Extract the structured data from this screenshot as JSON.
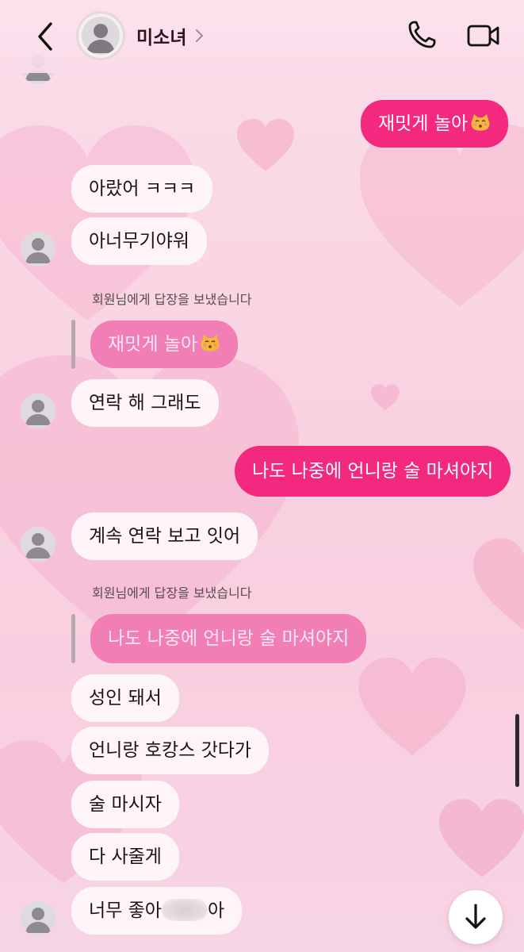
{
  "header": {
    "contact_name": "미소녀",
    "icons": {
      "back": "chevron-left-icon",
      "call": "phone-icon",
      "video": "video-camera-icon",
      "profile_more": "chevron-right-icon"
    }
  },
  "messages": {
    "m1": {
      "text": "재밋게 놀아",
      "emoji": "kissing-cat-emoji"
    },
    "m2": {
      "text": "아랐어 ㅋㅋㅋ"
    },
    "m3": {
      "text": "아너무기야워"
    },
    "reply1_note": "회원님에게 답장을 보냈습니다",
    "reply1_quote": {
      "text": "재밋게 놀아",
      "emoji": "kissing-cat-emoji"
    },
    "m4": {
      "text": "연락 해 그래도"
    },
    "m5": {
      "text": "나도 나중에 언니랑 술 마셔야지"
    },
    "m6": {
      "text": "계속 연락 보고 잇어"
    },
    "reply2_note": "회원님에게 답장을 보냈습니다",
    "reply2_quote": {
      "text": "나도 나중에 언니랑 술 마셔야지"
    },
    "m7": {
      "text": "성인 돼서"
    },
    "m8": {
      "text": "언니랑 호캉스 갓다가"
    },
    "m9": {
      "text": "술 마시자"
    },
    "m10": {
      "text": "다 사줄게"
    },
    "m11": {
      "text_before": "너무 좋아",
      "text_after": "아"
    }
  },
  "colors": {
    "sent_bubble": "#f3287f",
    "received_bubble": "#fdf5f8",
    "replied_bubble": "#f17fb6",
    "background": "#f9d3e2"
  },
  "scroll_button_icon": "arrow-down-icon"
}
